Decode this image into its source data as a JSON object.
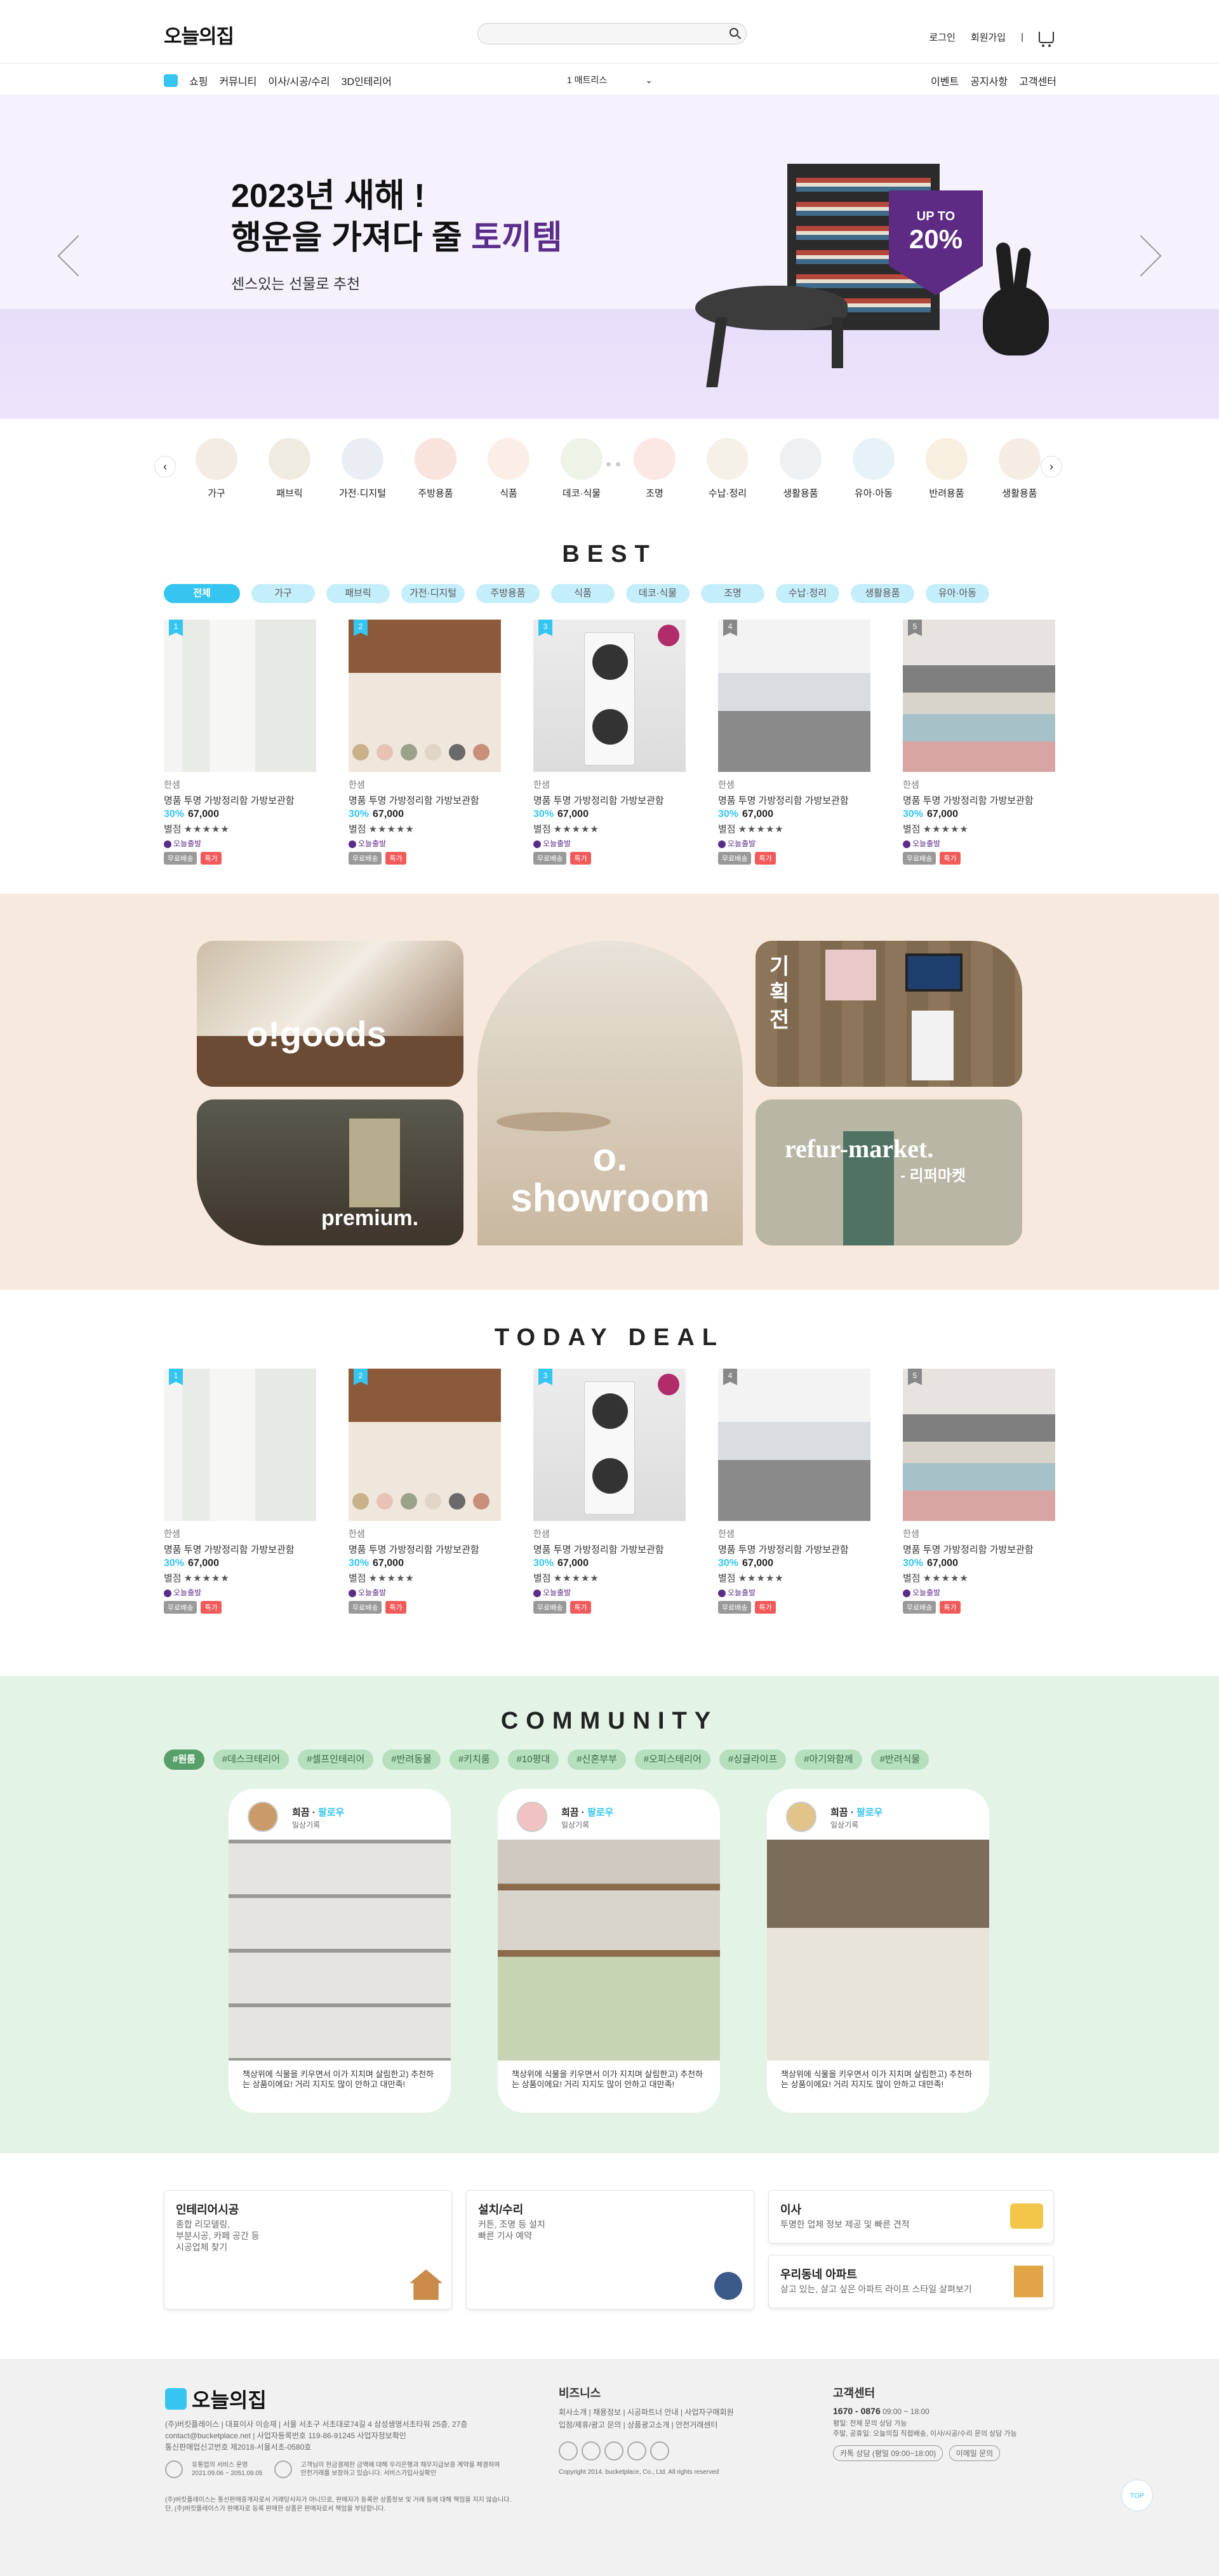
{
  "header": {
    "logo": "오늘의집",
    "login": "로그인",
    "signup": "회원가입",
    "sep": "|"
  },
  "nav": {
    "left": [
      "쇼핑",
      "커뮤니티",
      "이사/시공/수리",
      "3D인테리어"
    ],
    "mid": "1 매트리스",
    "right": [
      "이벤트",
      "공지사항",
      "고객센터"
    ]
  },
  "hero": {
    "line1": "2023년 새해 !",
    "line2_pre": "행운을 가져다 줄 ",
    "line2_hl": "토끼템",
    "sub": "센스있는 선물로 추천",
    "badge_top": "UP TO",
    "badge_num": "20%"
  },
  "categories": [
    "가구",
    "패브릭",
    "가전·디지털",
    "주방용품",
    "식품",
    "데코·식물",
    "조명",
    "수납·정리",
    "생활용품",
    "유아·아동",
    "반려용품",
    "생활용품"
  ],
  "best": {
    "title": "BEST",
    "chips": [
      "전체",
      "가구",
      "패브릭",
      "가전·디지털",
      "주방용품",
      "식품",
      "데코·식물",
      "조명",
      "수납·정리",
      "생활용품",
      "유아·아동"
    ]
  },
  "products": [
    {
      "rank": "1",
      "brand": "한샘",
      "name": "명품 투명 가방정리함 가방보관함",
      "pct": "30%",
      "price": "67,000",
      "review": "별점",
      "stars": "★★★★★",
      "icon": "오늘출발",
      "tag1": "무료배송",
      "tag2": "특가"
    },
    {
      "rank": "2",
      "brand": "한샘",
      "name": "명품 투명 가방정리함 가방보관함",
      "pct": "30%",
      "price": "67,000",
      "review": "별점",
      "stars": "★★★★★",
      "icon": "오늘출발",
      "tag1": "무료배송",
      "tag2": "특가"
    },
    {
      "rank": "3",
      "brand": "한샘",
      "name": "명품 투명 가방정리함 가방보관함",
      "pct": "30%",
      "price": "67,000",
      "review": "별점",
      "stars": "★★★★★",
      "icon": "오늘출발",
      "tag1": "무료배송",
      "tag2": "특가"
    },
    {
      "rank": "4",
      "brand": "한샘",
      "name": "명품 투명 가방정리함 가방보관함",
      "pct": "30%",
      "price": "67,000",
      "review": "별점",
      "stars": "★★★★★",
      "icon": "오늘출발",
      "tag1": "무료배송",
      "tag2": "특가"
    },
    {
      "rank": "5",
      "brand": "한샘",
      "name": "명품 투명 가방정리함 가방보관함",
      "pct": "30%",
      "price": "67,000",
      "review": "별점",
      "stars": "★★★★★",
      "icon": "오늘출발",
      "tag1": "무료배송",
      "tag2": "특가"
    }
  ],
  "plan": {
    "goods": "o!goods",
    "showroom_o": "o.",
    "showroom": "showroom",
    "exhibit": "기획전",
    "premium": "premium.",
    "refur": "refur-market.",
    "refur_kr": "- 리퍼마켓"
  },
  "today": {
    "title": "TODAY DEAL"
  },
  "community": {
    "title": "COMMUNITY",
    "chips": [
      "#원룸",
      "#데스크테리어",
      "#셀프인테리어",
      "#반려동물",
      "#키치룸",
      "#10평대",
      "#신혼부부",
      "#오피스테리어",
      "#싱글라이프",
      "#아기와함께",
      "#반려식물"
    ],
    "cards": [
      {
        "name": "희끔",
        "follow": "팔로우",
        "sub": "일상기록",
        "text": "책상위에 식물을 키우면서 이가 지치며 살림한고) 추천하는 상품이에요! 거리 지지도 많이 안하고 대만족!"
      },
      {
        "name": "희끔",
        "follow": "팔로우",
        "sub": "일상기록",
        "text": "책상위에 식물을 키우면서 이가 지치며 살림한고) 추천하는 상품이에요! 거리 지지도 많이 안하고 대만족!"
      },
      {
        "name": "희끔",
        "follow": "팔로우",
        "sub": "일상기록",
        "text": "책상위에 식물을 키우면서 이가 지치며 살림한고) 추천하는 상품이에요! 거리 지지도 많이 안하고 대만족!"
      }
    ]
  },
  "services": {
    "interior": {
      "title": "인테리어시공",
      "desc": [
        "종합 리모델링,",
        "부분시공, 카페 공간 등",
        "시공업체 찾기"
      ]
    },
    "repair": {
      "title": "설치/수리",
      "desc": [
        "커튼, 조명 등 설치",
        "빠른 기사 예약"
      ]
    },
    "moving": {
      "title": "이사",
      "desc": [
        "투명한 업체 정보 제공 및 빠른 견적"
      ]
    },
    "apt": {
      "title": "우리동네 아파트",
      "desc": [
        "살고 있는, 살고 싶은 아파트 라이프 스타일 살펴보기"
      ]
    }
  },
  "footer": {
    "logo": "오늘의집",
    "company": [
      "(주)버킷플레이스 | 대표이사 이승재 | 서울 서초구 서초대로74길 4 삼성생명서초타워 25층, 27층",
      "contact@bucketplace.net | 사업자등록번호 119-86-91245 사업자정보확인",
      "통신판매업신고번호 제2018-서울서초-0580호"
    ],
    "cert1": [
      "유통업의 서비스 운영",
      "2021.09.06 ~ 2051.09.05"
    ],
    "cert2": [
      "고객님이 현금결제한 금액에 대해 우리은행과 채무지급보증 계약을 체결하여",
      "안전거래를 보장하고 있습니다. 서비스가입사실확인"
    ],
    "notice": [
      "(주)버킷플레이스는 통신판매중개자로서 거래당사자가 아니므로, 판매자가 등록한 상품정보 및 거래 등에 대해 책임을 지지 않습니다.",
      "단, (주)버킷플레이스가 판매자로 등록 판매한 상품은 판매자로서 책임을 부담합니다."
    ],
    "biz_title": "비즈니스",
    "biz": [
      "회사소개 | 채용정보 | 시공파트너 안내 | 사업자구매회원",
      "입점/제휴/광고 문의 | 상품광고소개 | 안전거래센터"
    ],
    "copyright": "Copyright 2014. bucketplace, Co., Ltd. All rights reserved",
    "cs_title": "고객센터",
    "phone": "1670 - 0876",
    "hours": "09:00 ~ 18:00",
    "cs_info": [
      "평일: 전체 문의 상담 가능",
      "주말, 공휴일: 오늘의집 직접배송, 이사/시공/수리 문의 상담 가능"
    ],
    "btn1": "카톡 상담 (평일 09:00~18:00)",
    "btn2": "이메일 문의",
    "top": "TOP"
  }
}
